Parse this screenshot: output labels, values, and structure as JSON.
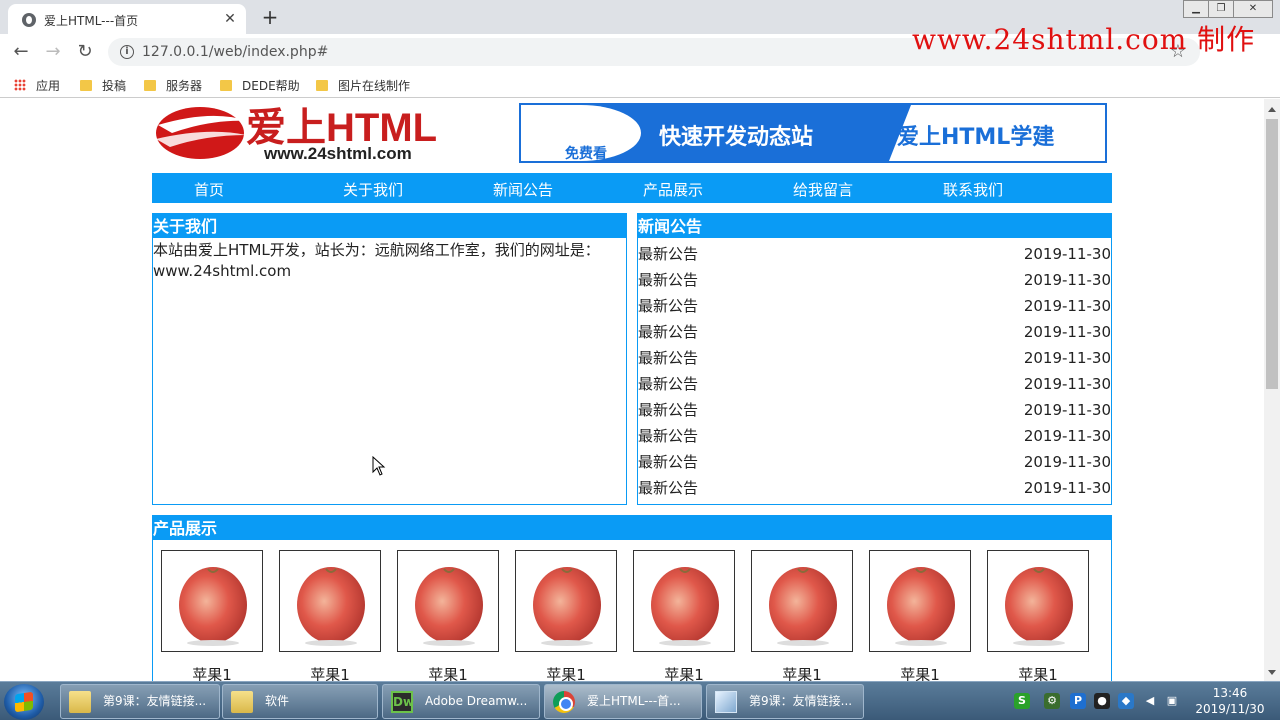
{
  "browser": {
    "tab_title": "爱上HTML---首页",
    "url": "127.0.0.1/web/index.php#",
    "watermark": "www.24shtml.com 制作",
    "bookmarks": [
      {
        "label": "应用",
        "icon": "apps-icon"
      },
      {
        "label": "投稿",
        "icon": "folder-icon"
      },
      {
        "label": "服务器",
        "icon": "folder-icon"
      },
      {
        "label": "DEDE帮助",
        "icon": "folder-icon"
      },
      {
        "label": "图片在线制作",
        "icon": "folder-icon"
      }
    ]
  },
  "site": {
    "logo_text": "爱上HTML",
    "logo_url": "www.24shtml.com",
    "banner": {
      "free": "免费看",
      "slogan": "快速开发动态站",
      "brand": "爱上HTML学建"
    },
    "nav": [
      "首页",
      "关于我们",
      "新闻公告",
      "产品展示",
      "给我留言",
      "联系我们"
    ],
    "about": {
      "title": "关于我们",
      "body": "本站由爱上HTML开发，站长为：远航网络工作室，我们的网址是：www.24shtml.com"
    },
    "news": {
      "title": "新闻公告",
      "items": [
        {
          "title": "最新公告",
          "date": "2019-11-30"
        },
        {
          "title": "最新公告",
          "date": "2019-11-30"
        },
        {
          "title": "最新公告",
          "date": "2019-11-30"
        },
        {
          "title": "最新公告",
          "date": "2019-11-30"
        },
        {
          "title": "最新公告",
          "date": "2019-11-30"
        },
        {
          "title": "最新公告",
          "date": "2019-11-30"
        },
        {
          "title": "最新公告",
          "date": "2019-11-30"
        },
        {
          "title": "最新公告",
          "date": "2019-11-30"
        },
        {
          "title": "最新公告",
          "date": "2019-11-30"
        },
        {
          "title": "最新公告",
          "date": "2019-11-30"
        }
      ]
    },
    "products": {
      "title": "产品展示",
      "items": [
        "苹果1",
        "苹果1",
        "苹果1",
        "苹果1",
        "苹果1",
        "苹果1",
        "苹果1",
        "苹果1"
      ]
    }
  },
  "taskbar": {
    "tasks": [
      {
        "label": "第9课：友情链接...",
        "icon": "folder-icon"
      },
      {
        "label": "软件",
        "icon": "folder-icon"
      },
      {
        "label": "Adobe Dreamw...",
        "icon": "dreamweaver-icon"
      },
      {
        "label": "爱上HTML---首...",
        "icon": "chrome-icon"
      },
      {
        "label": "第9课：友情链接...",
        "icon": "notepad-icon"
      }
    ],
    "time": "13:46",
    "date": "2019/11/30"
  }
}
